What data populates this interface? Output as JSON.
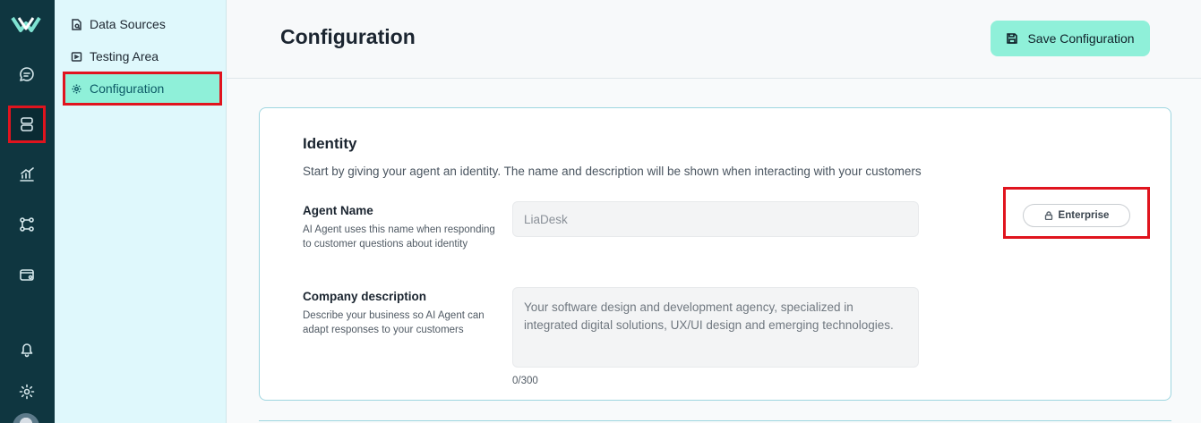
{
  "rail": {
    "icons": [
      "logo-icon",
      "chat-icon",
      "database-icon",
      "analytics-icon",
      "workflow-icon",
      "wallet-icon",
      "bell-icon",
      "gear-icon"
    ]
  },
  "subnav": {
    "items": [
      {
        "label": "Data Sources",
        "icon": "data-sources-icon"
      },
      {
        "label": "Testing Area",
        "icon": "testing-area-icon"
      },
      {
        "label": "Configuration",
        "icon": "gear-icon",
        "active": true
      }
    ]
  },
  "header": {
    "title": "Configuration",
    "save_label": "Save Configuration"
  },
  "identity": {
    "title": "Identity",
    "description": "Start by giving your agent an identity. The name and description will be shown when interacting with your customers",
    "agent_name": {
      "label": "Agent Name",
      "help": "AI Agent uses this name when responding to customer questions about identity",
      "value": "LiaDesk"
    },
    "company_description": {
      "label": "Company description",
      "help": "Describe your business so AI Agent can adapt responses to your customers",
      "value": "Your software design and development agency, specialized in integrated digital solutions, UX/UI design and emerging technologies.",
      "counter": "0/300"
    },
    "plan_badge": "Enterprise"
  },
  "colors": {
    "rail_bg": "#0f3640",
    "subnav_bg": "#dff8fc",
    "accent": "#8ff0d9",
    "highlight_red": "#e0141e",
    "card_border": "#9fd6e0"
  }
}
